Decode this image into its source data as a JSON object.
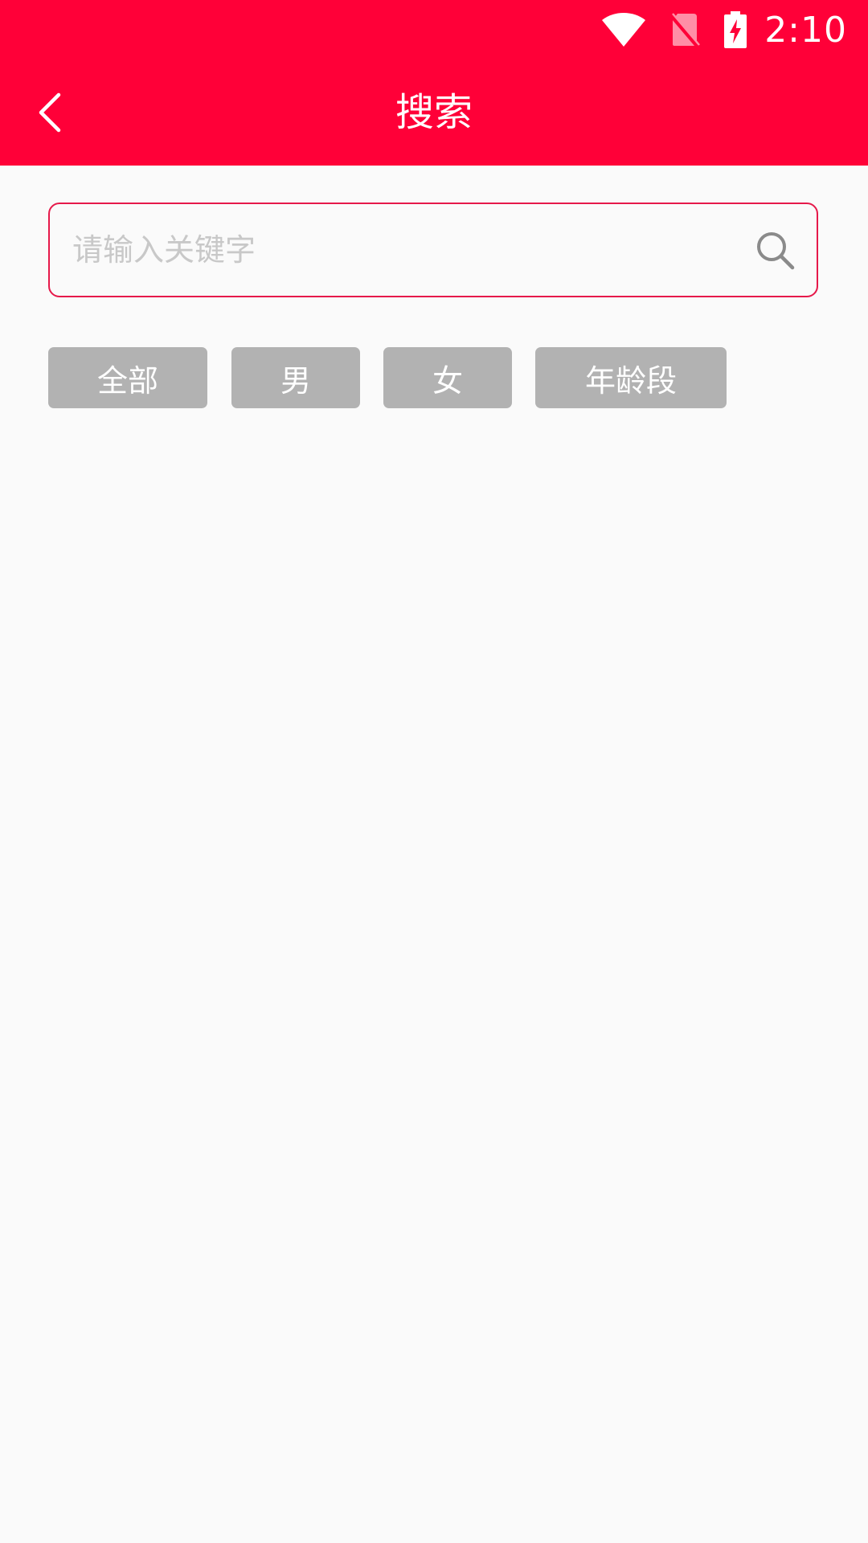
{
  "status_bar": {
    "time": "2:10",
    "icons": [
      "wifi-icon",
      "no-sim-icon",
      "battery-charging-icon"
    ]
  },
  "header": {
    "title": "搜索",
    "back_icon": "chevron-left-icon"
  },
  "search": {
    "placeholder": "请输入关键字",
    "value": "",
    "icon": "search-icon"
  },
  "filters": [
    {
      "label": "全部"
    },
    {
      "label": "男"
    },
    {
      "label": "女"
    },
    {
      "label": "年龄段"
    }
  ],
  "colors": {
    "brand": "#ff0038",
    "search_border": "#e6194a",
    "filter_bg": "#b2b2b2",
    "page_bg": "#fafafa",
    "placeholder": "#c8c8c8"
  }
}
